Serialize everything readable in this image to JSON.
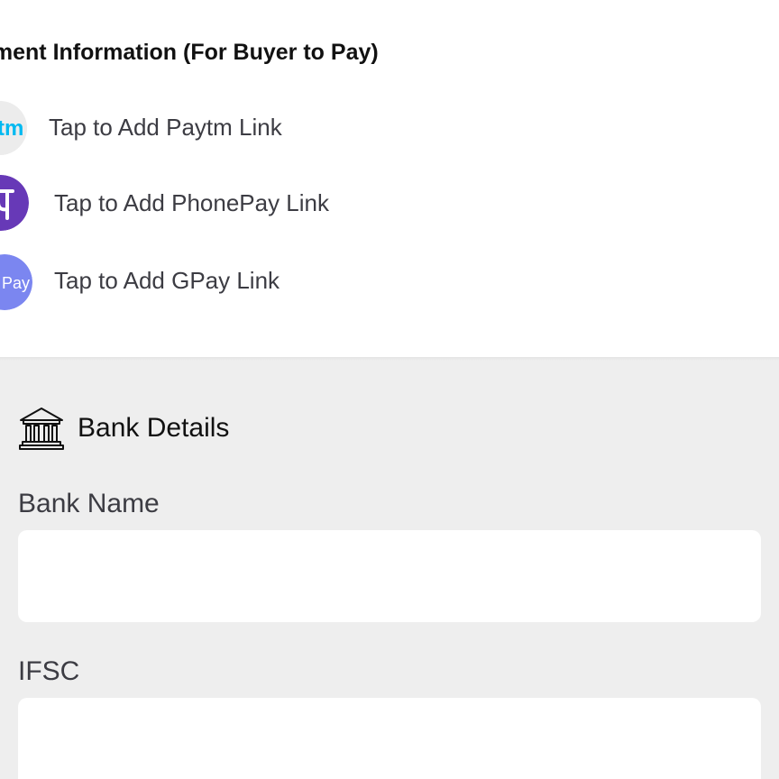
{
  "payment": {
    "title": "yment Information (For Buyer to Pay)",
    "options": [
      {
        "label": "Tap to Add Paytm Link",
        "icon": "paytm-icon",
        "icon_text": "tm",
        "color": "#00b9f1"
      },
      {
        "label": "Tap to Add PhonePay Link",
        "icon": "phonepe-icon",
        "icon_text": "पे",
        "color": "#6739b7"
      },
      {
        "label": "Tap to Add GPay Link",
        "icon": "gpay-icon",
        "icon_text": "Pay",
        "color": "#7b86f0"
      }
    ]
  },
  "bank": {
    "title": "Bank Details",
    "icon": "bank-icon",
    "fields": [
      {
        "label": "Bank Name",
        "value": "",
        "placeholder": ""
      },
      {
        "label": "IFSC",
        "value": "",
        "placeholder": ""
      }
    ]
  },
  "colors": {
    "bank_background": "#eeeeee",
    "input_background": "#ffffff",
    "label_text": "#3c3c43"
  }
}
